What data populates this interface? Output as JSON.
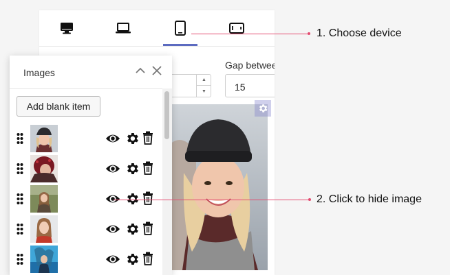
{
  "device_bar": {
    "devices": [
      {
        "name": "desktop",
        "icon": "desktop-icon",
        "active": false
      },
      {
        "name": "laptop",
        "icon": "laptop-icon",
        "active": false
      },
      {
        "name": "tablet",
        "icon": "tablet-icon",
        "active": true
      },
      {
        "name": "mobile",
        "icon": "mobile-landscape-icon",
        "active": false
      }
    ],
    "accent_color": "#5c6bc0"
  },
  "settings": {
    "gap_label": "Gap betwee",
    "gap_value": "15"
  },
  "images_panel": {
    "title": "Images",
    "add_button_label": "Add blank item",
    "items": [
      {
        "thumb": "woman-knit-hat"
      },
      {
        "thumb": "woman-red-hair"
      },
      {
        "thumb": "woman-forest"
      },
      {
        "thumb": "woman-portrait"
      },
      {
        "thumb": "woman-blue-water"
      }
    ]
  },
  "callouts": {
    "choose_device": "1. Choose device",
    "hide_image": "2. Click to hide image",
    "color": "#e34a6f"
  }
}
